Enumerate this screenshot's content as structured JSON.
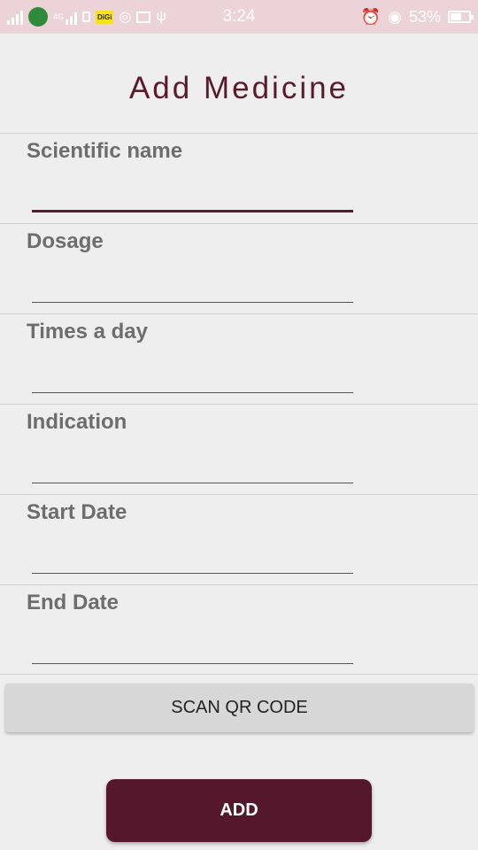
{
  "status_bar": {
    "time": "3:24",
    "network_label": "4G",
    "carrier_badge": "DiGi",
    "battery": "53%",
    "icons": [
      "signal-icon",
      "app-icon",
      "signal-4g-icon",
      "sim-icon",
      "digi-icon",
      "wifi-icon",
      "image-icon",
      "usb-icon",
      "alarm-icon",
      "eye-icon",
      "battery-icon"
    ]
  },
  "page": {
    "title": "Add Medicine"
  },
  "fields": [
    {
      "label": "Scientific name",
      "value": ""
    },
    {
      "label": "Dosage",
      "value": ""
    },
    {
      "label": "Times a day",
      "value": ""
    },
    {
      "label": "Indication",
      "value": ""
    },
    {
      "label": "Start Date",
      "value": ""
    },
    {
      "label": "End Date",
      "value": ""
    }
  ],
  "buttons": {
    "scan_qr": "SCAN QR CODE",
    "add": "ADD"
  },
  "colors": {
    "accent": "#5a1a2c",
    "add_button": "#54172c",
    "status_bar": "#ecd3d8",
    "label": "#6d6d6d"
  }
}
